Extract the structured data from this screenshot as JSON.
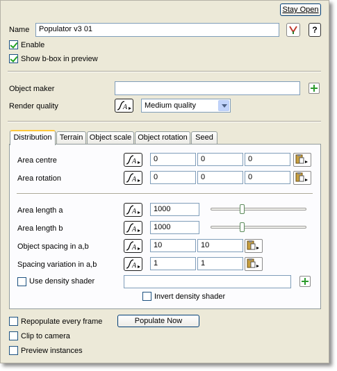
{
  "header": {
    "stay_open": "Stay Open",
    "help": "?"
  },
  "name": {
    "label": "Name",
    "value": "Populator v3 01"
  },
  "enable": {
    "label": "Enable",
    "checked": true
  },
  "show_bbox": {
    "label": "Show b-box in preview",
    "checked": true
  },
  "object_maker": {
    "label": "Object maker",
    "value": ""
  },
  "render_quality": {
    "label": "Render quality",
    "selected": "Medium quality"
  },
  "tabs": [
    "Distribution",
    "Terrain",
    "Object scale",
    "Object rotation",
    "Seed"
  ],
  "active_tab": "Distribution",
  "distribution": {
    "area_centre": {
      "label": "Area centre",
      "values": [
        "0",
        "0",
        "0"
      ]
    },
    "area_rotation": {
      "label": "Area rotation",
      "values": [
        "0",
        "0",
        "0"
      ]
    },
    "area_length_a": {
      "label": "Area length a",
      "value": "1000"
    },
    "area_length_b": {
      "label": "Area length b",
      "value": "1000"
    },
    "object_spacing": {
      "label": "Object spacing in a,b",
      "values": [
        "10",
        "10"
      ]
    },
    "spacing_variation": {
      "label": "Spacing variation in a,b",
      "values": [
        "1",
        "1"
      ]
    },
    "use_density_shader": {
      "label": "Use density shader",
      "checked": false,
      "value": ""
    },
    "invert_density_shader": {
      "label": "Invert density shader",
      "checked": false
    }
  },
  "repopulate": {
    "label": "Repopulate every frame",
    "checked": false
  },
  "populate_now": "Populate Now",
  "clip_to_camera": {
    "label": "Clip to camera",
    "checked": false
  },
  "preview_instances": {
    "label": "Preview instances",
    "checked": false
  },
  "icons": {
    "fx": "function-curve-icon",
    "clip": "clipboard-icon",
    "plus": "plus-icon",
    "pick": "eyedropper-icon"
  },
  "colors": {
    "panel": "#ece9d8",
    "tab_highlight": "#ffc83c",
    "check": "#21a121"
  }
}
